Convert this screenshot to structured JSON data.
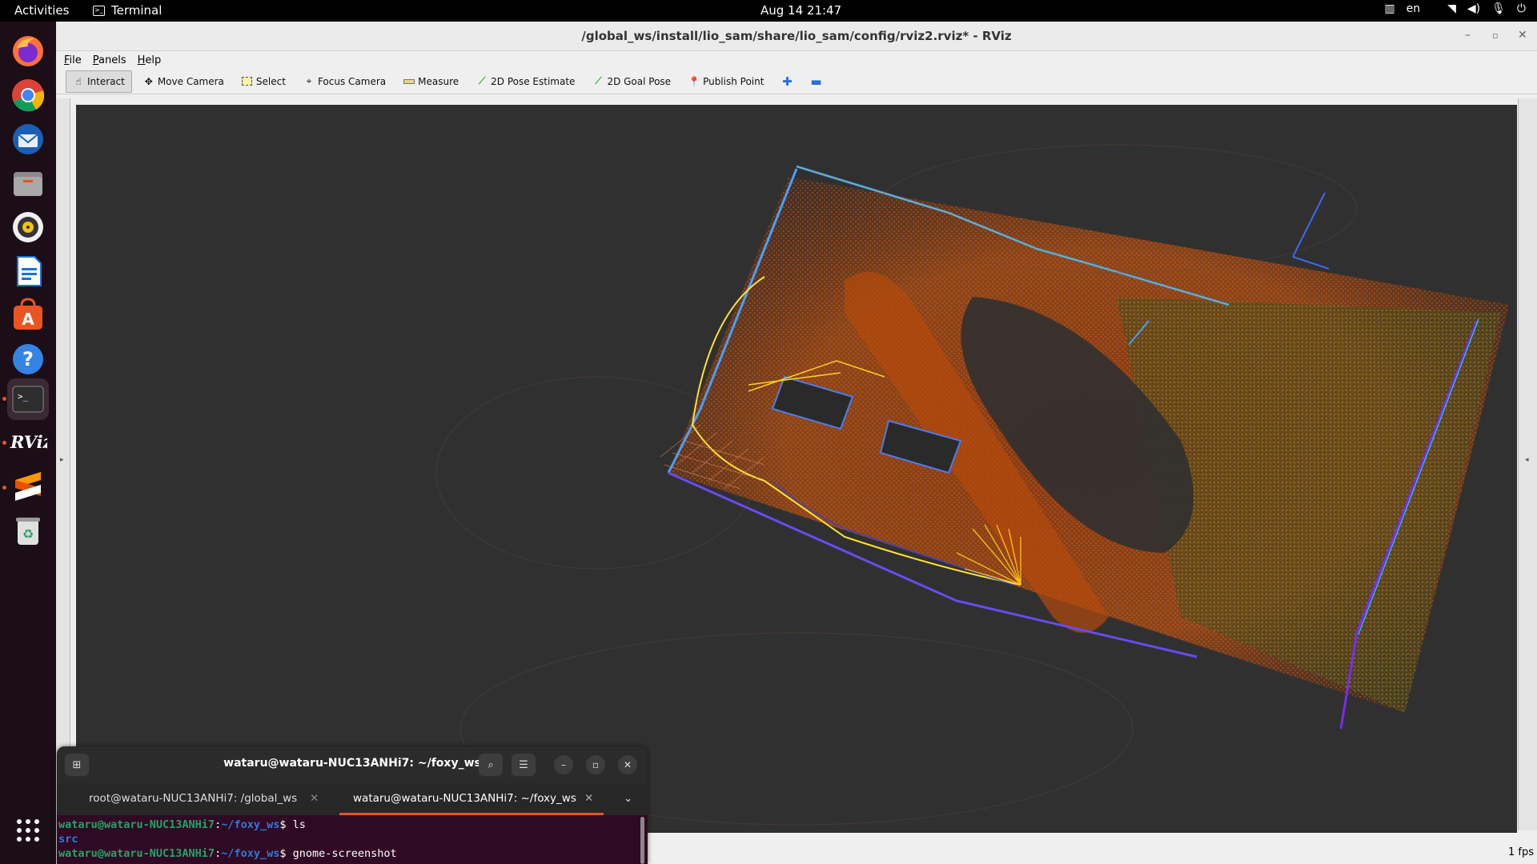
{
  "topbar": {
    "activities": "Activities",
    "app_name": "Terminal",
    "clock": "Aug 14  21:47",
    "lang": "en"
  },
  "dock": {
    "items": [
      "firefox-icon",
      "chrome-icon",
      "thunderbird-icon",
      "files-icon",
      "rhythmbox-icon",
      "writer-icon",
      "software-icon",
      "help-icon",
      "terminal-icon",
      "rviz-icon",
      "sublime-icon",
      "trash-icon"
    ],
    "apps_label": "Show Applications"
  },
  "rviz": {
    "title": "/global_ws/install/lio_sam/share/lio_sam/config/rviz2.rviz* - RViz",
    "menu": [
      "File",
      "Panels",
      "Help"
    ],
    "tools": [
      "Interact",
      "Move Camera",
      "Select",
      "Focus Camera",
      "Measure",
      "2D Pose Estimate",
      "2D Goal Pose",
      "Publish Point"
    ],
    "fps": "1 fps"
  },
  "terminal": {
    "title": "wataru@wataru-NUC13ANHi7: ~/foxy_ws",
    "tabs": [
      "root@wataru-NUC13ANHi7: /global_ws",
      "wataru@wataru-NUC13ANHi7: ~/foxy_ws"
    ],
    "lines": [
      {
        "user": "wataru@wataru-NUC13ANHi7",
        "path": "~/foxy_ws",
        "cmd": "ls"
      },
      {
        "output": "src"
      },
      {
        "user": "wataru@wataru-NUC13ANHi7",
        "path": "~/foxy_ws",
        "cmd": "gnome-screenshot"
      }
    ]
  }
}
